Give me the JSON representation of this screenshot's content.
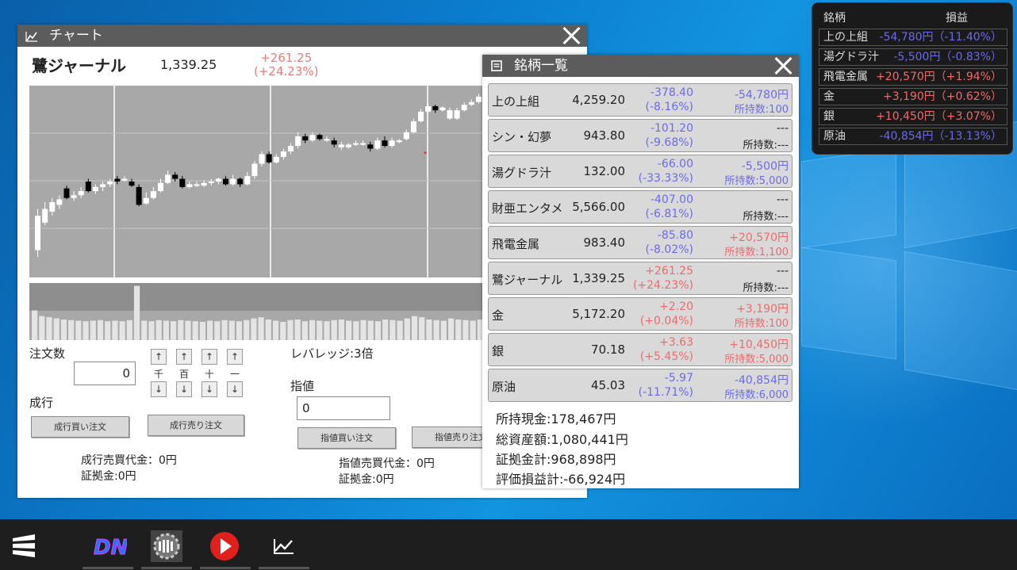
{
  "chart_window": {
    "title": "チャート",
    "stock_name": "鷺ジャーナル",
    "price": "1,339.25",
    "change_amount": "+261.25",
    "change_pct": "(+24.23%)",
    "order_qty_label": "注文数",
    "order_qty_value": "0",
    "step_labels": [
      "千",
      "百",
      "十",
      "一"
    ],
    "up_arrow": "↑",
    "down_arrow": "↓",
    "market_label": "成行",
    "market_buy": "成行買い注文",
    "market_sell": "成行売り注文",
    "leverage": "レバレッジ:3倍",
    "limit_label": "指値",
    "limit_value": "0",
    "limit_buy": "指値買い注文",
    "limit_sell": "指値売り注文",
    "market_amount": "成行売買代金：0円",
    "market_margin": "証拠金:0円",
    "limit_amount": "指値売買代金：0円",
    "limit_margin": "証拠金:0円"
  },
  "chart_data": {
    "type": "candlestick",
    "candles": [
      [
        250,
        275,
        245,
        280,
        "up"
      ],
      [
        270,
        280,
        268,
        285,
        "up"
      ],
      [
        278,
        285,
        275,
        288,
        "up"
      ],
      [
        283,
        287,
        280,
        290,
        "up"
      ],
      [
        295,
        288,
        287,
        297,
        "down"
      ],
      [
        288,
        290,
        286,
        293,
        "up"
      ],
      [
        290,
        293,
        288,
        296,
        "up"
      ],
      [
        300,
        293,
        292,
        302,
        "down"
      ],
      [
        293,
        296,
        291,
        298,
        "up"
      ],
      [
        296,
        298,
        293,
        300,
        "up"
      ],
      [
        298,
        300,
        296,
        302,
        "up"
      ],
      [
        300,
        302,
        298,
        304,
        "down"
      ],
      [
        302,
        302,
        300,
        304,
        "up"
      ],
      [
        300,
        297,
        296,
        302,
        "down"
      ],
      [
        296,
        283,
        282,
        298,
        "down"
      ],
      [
        284,
        288,
        283,
        292,
        "up"
      ],
      [
        288,
        293,
        287,
        296,
        "up"
      ],
      [
        293,
        299,
        292,
        302,
        "up"
      ],
      [
        299,
        305,
        298,
        308,
        "up"
      ],
      [
        305,
        302,
        300,
        307,
        "down"
      ],
      [
        302,
        296,
        295,
        304,
        "down"
      ],
      [
        296,
        298,
        295,
        300,
        "up"
      ],
      [
        298,
        297,
        296,
        300,
        "up"
      ],
      [
        297,
        299,
        296,
        301,
        "up"
      ],
      [
        299,
        300,
        297,
        302,
        "up"
      ],
      [
        300,
        302,
        298,
        303,
        "up"
      ],
      [
        302,
        298,
        297,
        304,
        "down"
      ],
      [
        298,
        302,
        297,
        305,
        "up"
      ],
      [
        302,
        298,
        296,
        303,
        "down"
      ],
      [
        298,
        304,
        297,
        307,
        "up"
      ],
      [
        304,
        313,
        302,
        315,
        "up"
      ],
      [
        313,
        320,
        311,
        322,
        "up"
      ],
      [
        320,
        314,
        313,
        322,
        "down"
      ],
      [
        314,
        318,
        313,
        320,
        "up"
      ],
      [
        318,
        322,
        316,
        324,
        "up"
      ],
      [
        322,
        326,
        320,
        328,
        "up"
      ],
      [
        326,
        333,
        324,
        336,
        "up"
      ],
      [
        333,
        330,
        328,
        335,
        "down"
      ],
      [
        330,
        334,
        329,
        336,
        "up"
      ],
      [
        334,
        331,
        330,
        335,
        "down"
      ],
      [
        331,
        330,
        329,
        333,
        "up"
      ],
      [
        330,
        327,
        325,
        332,
        "down"
      ],
      [
        327,
        325,
        323,
        329,
        "up"
      ],
      [
        325,
        327,
        324,
        328,
        "up"
      ],
      [
        327,
        328,
        326,
        330,
        "up"
      ],
      [
        328,
        327,
        326,
        330,
        "up"
      ],
      [
        327,
        324,
        322,
        329,
        "down"
      ],
      [
        324,
        330,
        323,
        332,
        "up"
      ],
      [
        330,
        326,
        325,
        333,
        "down"
      ],
      [
        326,
        330,
        325,
        332,
        "up"
      ],
      [
        330,
        329,
        328,
        331,
        "up"
      ],
      [
        331,
        336,
        330,
        338,
        "up"
      ],
      [
        336,
        344,
        335,
        346,
        "up"
      ],
      [
        344,
        351,
        343,
        353,
        "up"
      ],
      [
        351,
        355,
        350,
        357,
        "up"
      ],
      [
        355,
        352,
        350,
        356,
        "down"
      ],
      [
        352,
        354,
        351,
        355,
        "up"
      ],
      [
        352,
        346,
        345,
        354,
        "up"
      ],
      [
        346,
        352,
        345,
        354,
        "up"
      ],
      [
        352,
        356,
        351,
        358,
        "up"
      ],
      [
        356,
        358,
        355,
        360,
        "up"
      ],
      [
        358,
        362,
        357,
        364,
        "up"
      ]
    ],
    "volume": [
      52,
      42,
      40,
      38,
      36,
      35,
      34,
      33,
      34,
      35,
      33,
      34,
      33,
      35,
      95,
      34,
      33,
      35,
      34,
      33,
      35,
      34,
      33,
      32,
      34,
      33,
      35,
      34,
      33,
      35,
      38,
      40,
      36,
      34,
      32,
      35,
      36,
      33,
      35,
      34,
      33,
      35,
      36,
      34,
      33,
      35,
      34,
      33,
      36,
      35,
      34,
      38,
      42,
      40,
      36,
      35,
      34,
      38,
      36,
      35,
      34,
      36
    ],
    "marker": [
      82,
      321
    ]
  },
  "list_window": {
    "title": "銘柄一覧",
    "holding_label": "所持数",
    "rows": [
      {
        "name": "上の上組",
        "price": "4,259.20",
        "ch": "-378.40",
        "pct": "(-8.16%)",
        "pl": "-54,780円",
        "hold": "所持数:100",
        "ch_cls": "neg",
        "pl_cls": "neg",
        "hold_cls": "neg"
      },
      {
        "name": "シン・幻夢",
        "price": "943.80",
        "ch": "-101.20",
        "pct": "(-9.68%)",
        "pl": "---",
        "hold": "所持数:---",
        "ch_cls": "neg",
        "pl_cls": "dark",
        "hold_cls": "dark"
      },
      {
        "name": "湯グドラ汁",
        "price": "132.00",
        "ch": "-66.00",
        "pct": "(-33.33%)",
        "pl": "-5,500円",
        "hold": "所持数:5,000",
        "ch_cls": "neg",
        "pl_cls": "neg",
        "hold_cls": "neg"
      },
      {
        "name": "財亜エンタメ",
        "price": "5,566.00",
        "ch": "-407.00",
        "pct": "(-6.81%)",
        "pl": "---",
        "hold": "所持数:---",
        "ch_cls": "neg",
        "pl_cls": "dark",
        "hold_cls": "dark"
      },
      {
        "name": "飛電金属",
        "price": "983.40",
        "ch": "-85.80",
        "pct": "(-8.02%)",
        "pl": "+20,570円",
        "hold": "所持数:1,100",
        "ch_cls": "neg",
        "pl_cls": "pos",
        "hold_cls": "pos"
      },
      {
        "name": "鷺ジャーナル",
        "price": "1,339.25",
        "ch": "+261.25",
        "pct": "(+24.23%)",
        "pl": "---",
        "hold": "所持数:---",
        "ch_cls": "pos",
        "pl_cls": "dark",
        "hold_cls": "dark"
      },
      {
        "name": "金",
        "price": "5,172.20",
        "ch": "+2.20",
        "pct": "(+0.04%)",
        "pl": "+3,190円",
        "hold": "所持数:100",
        "ch_cls": "pos",
        "pl_cls": "pos",
        "hold_cls": "pos"
      },
      {
        "name": "銀",
        "price": "70.18",
        "ch": "+3.63",
        "pct": "(+5.45%)",
        "pl": "+10,450円",
        "hold": "所持数:5,000",
        "ch_cls": "pos",
        "pl_cls": "pos",
        "hold_cls": "pos"
      },
      {
        "name": "原油",
        "price": "45.03",
        "ch": "-5.97",
        "pct": "(-11.71%)",
        "pl": "-40,854円",
        "hold": "所持数:6,000",
        "ch_cls": "neg",
        "pl_cls": "neg",
        "hold_cls": "neg"
      }
    ],
    "cash": "所持現金:178,467円",
    "total_assets": "総資産額:1,080,441円",
    "margin_total": "証拠金計:968,898円",
    "unrealized": "評価損益計:-66,924円"
  },
  "pl_panel": {
    "header_name": "銘柄",
    "header_pl": "損益",
    "rows": [
      {
        "name": "上の上組",
        "value": "-54,780円（-11.40%）",
        "cls": "neg"
      },
      {
        "name": "湯グドラ汁",
        "value": "-5,500円（-0.83%）",
        "cls": "neg"
      },
      {
        "name": "飛電金属",
        "value": "+20,570円（+1.94%）",
        "cls": "pos"
      },
      {
        "name": "金",
        "value": "+3,190円（+0.62%）",
        "cls": "pos"
      },
      {
        "name": "銀",
        "value": "+10,450円（+3.07%）",
        "cls": "pos"
      },
      {
        "name": "原油",
        "value": "-40,854円（-13.13%）",
        "cls": "neg"
      }
    ]
  },
  "taskbar": {
    "items": [
      "start-menu-icon",
      "dn-app-icon",
      "gear-app-icon",
      "play-app-icon",
      "chart-app-icon"
    ]
  },
  "colors": {
    "negative": "#6a6aee",
    "positive": "#f06a6a",
    "titlebar": "#5c5c5c"
  }
}
